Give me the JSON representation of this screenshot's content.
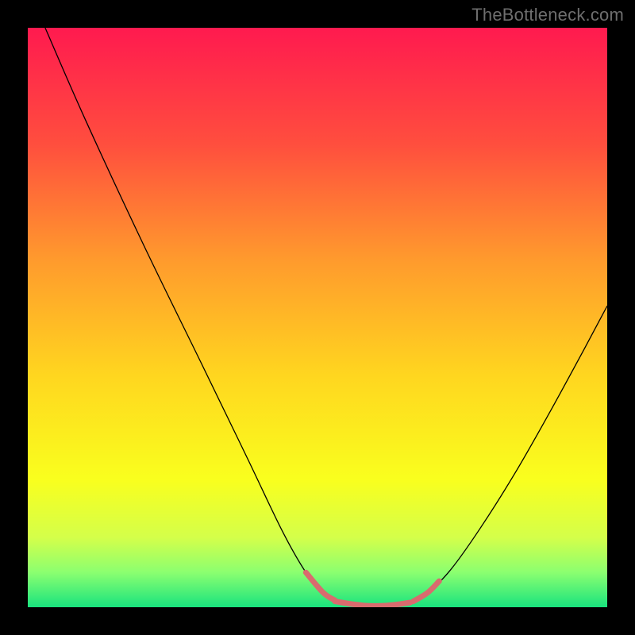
{
  "watermark": "TheBottleneck.com",
  "chart_data": {
    "type": "line",
    "title": "",
    "xlabel": "",
    "ylabel": "",
    "xlim": [
      0,
      100
    ],
    "ylim": [
      0,
      100
    ],
    "background_gradient": {
      "stops": [
        {
          "offset": 0.0,
          "color": "#ff1a4f"
        },
        {
          "offset": 0.2,
          "color": "#ff4e3e"
        },
        {
          "offset": 0.4,
          "color": "#ff9a2d"
        },
        {
          "offset": 0.6,
          "color": "#ffd61f"
        },
        {
          "offset": 0.78,
          "color": "#f9ff1e"
        },
        {
          "offset": 0.88,
          "color": "#d4ff4a"
        },
        {
          "offset": 0.94,
          "color": "#8bff70"
        },
        {
          "offset": 1.0,
          "color": "#19e37e"
        }
      ]
    },
    "series": [
      {
        "name": "bottleneck-curve",
        "color": "#000000",
        "width": 1.3,
        "points": [
          {
            "x": 3.0,
            "y": 100.0
          },
          {
            "x": 10.0,
            "y": 84.0
          },
          {
            "x": 20.0,
            "y": 62.5
          },
          {
            "x": 30.0,
            "y": 42.0
          },
          {
            "x": 38.0,
            "y": 25.5
          },
          {
            "x": 44.0,
            "y": 13.0
          },
          {
            "x": 48.0,
            "y": 6.0
          },
          {
            "x": 51.0,
            "y": 2.5
          },
          {
            "x": 54.0,
            "y": 0.8
          },
          {
            "x": 58.0,
            "y": 0.3
          },
          {
            "x": 62.0,
            "y": 0.3
          },
          {
            "x": 66.0,
            "y": 0.8
          },
          {
            "x": 69.0,
            "y": 2.5
          },
          {
            "x": 73.0,
            "y": 6.5
          },
          {
            "x": 78.0,
            "y": 13.5
          },
          {
            "x": 84.0,
            "y": 23.0
          },
          {
            "x": 90.0,
            "y": 33.5
          },
          {
            "x": 96.0,
            "y": 44.5
          },
          {
            "x": 100.0,
            "y": 52.0
          }
        ]
      },
      {
        "name": "highlight-segment-left",
        "color": "#d96b6e",
        "width": 7,
        "cap": "round",
        "points": [
          {
            "x": 48.0,
            "y": 6.0
          },
          {
            "x": 51.0,
            "y": 2.5
          },
          {
            "x": 53.0,
            "y": 1.2
          }
        ]
      },
      {
        "name": "highlight-segment-mid",
        "color": "#d96b6e",
        "width": 7,
        "cap": "round",
        "points": [
          {
            "x": 53.0,
            "y": 1.0
          },
          {
            "x": 58.0,
            "y": 0.3
          },
          {
            "x": 62.0,
            "y": 0.3
          },
          {
            "x": 66.0,
            "y": 0.8
          }
        ]
      },
      {
        "name": "highlight-segment-right",
        "color": "#d96b6e",
        "width": 7,
        "cap": "round",
        "points": [
          {
            "x": 66.5,
            "y": 1.0
          },
          {
            "x": 69.0,
            "y": 2.5
          },
          {
            "x": 71.0,
            "y": 4.5
          }
        ]
      }
    ]
  }
}
